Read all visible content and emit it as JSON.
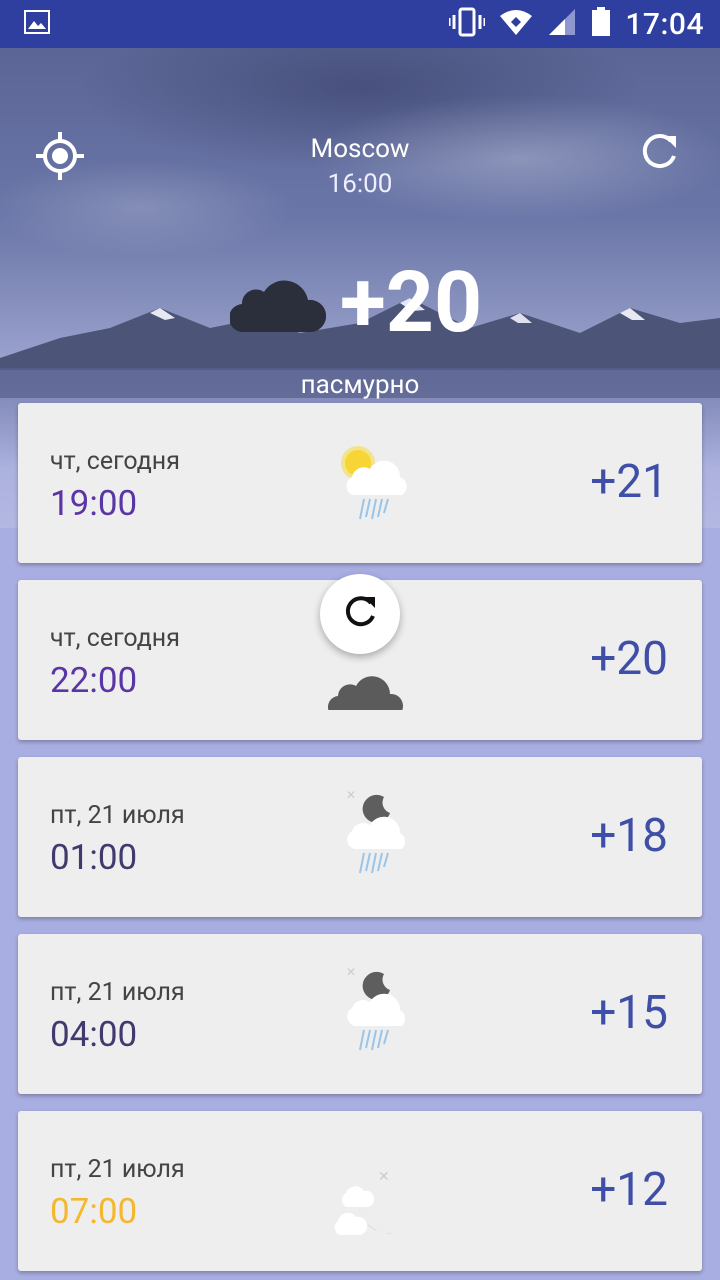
{
  "status_bar": {
    "time": "17:04",
    "icons": [
      "image-icon",
      "vibrate-icon",
      "wifi-icon",
      "signal-icon",
      "battery-icon"
    ]
  },
  "header": {
    "city": "Moscow",
    "observed_time": "16:00",
    "temperature": "+20",
    "condition": "пасмурно",
    "condition_icon": "cloud-icon"
  },
  "forecast": [
    {
      "date": "чт, сегодня",
      "time": "19:00",
      "time_color": "#5a35a5",
      "icon": "sun-cloud-rain-icon",
      "temp": "+21"
    },
    {
      "date": "чт, сегодня",
      "time": "22:00",
      "time_color": "#5a35a5",
      "icon": "cloud-icon",
      "temp": "+20"
    },
    {
      "date": "пт, 21 июля",
      "time": "01:00",
      "time_color": "#403a6e",
      "icon": "moon-cloud-rain-icon",
      "temp": "+18"
    },
    {
      "date": "пт, 21 июля",
      "time": "04:00",
      "time_color": "#403a6e",
      "icon": "moon-cloud-rain-icon",
      "temp": "+15"
    },
    {
      "date": "пт, 21 июля",
      "time": "07:00",
      "time_color": "#f4b830",
      "icon": "moon-cloud-icon",
      "temp": "+12"
    }
  ],
  "colors": {
    "status_bar": "#2f3fa0",
    "temp_text": "#3f4ea6",
    "card_bg": "#eeeeee"
  }
}
